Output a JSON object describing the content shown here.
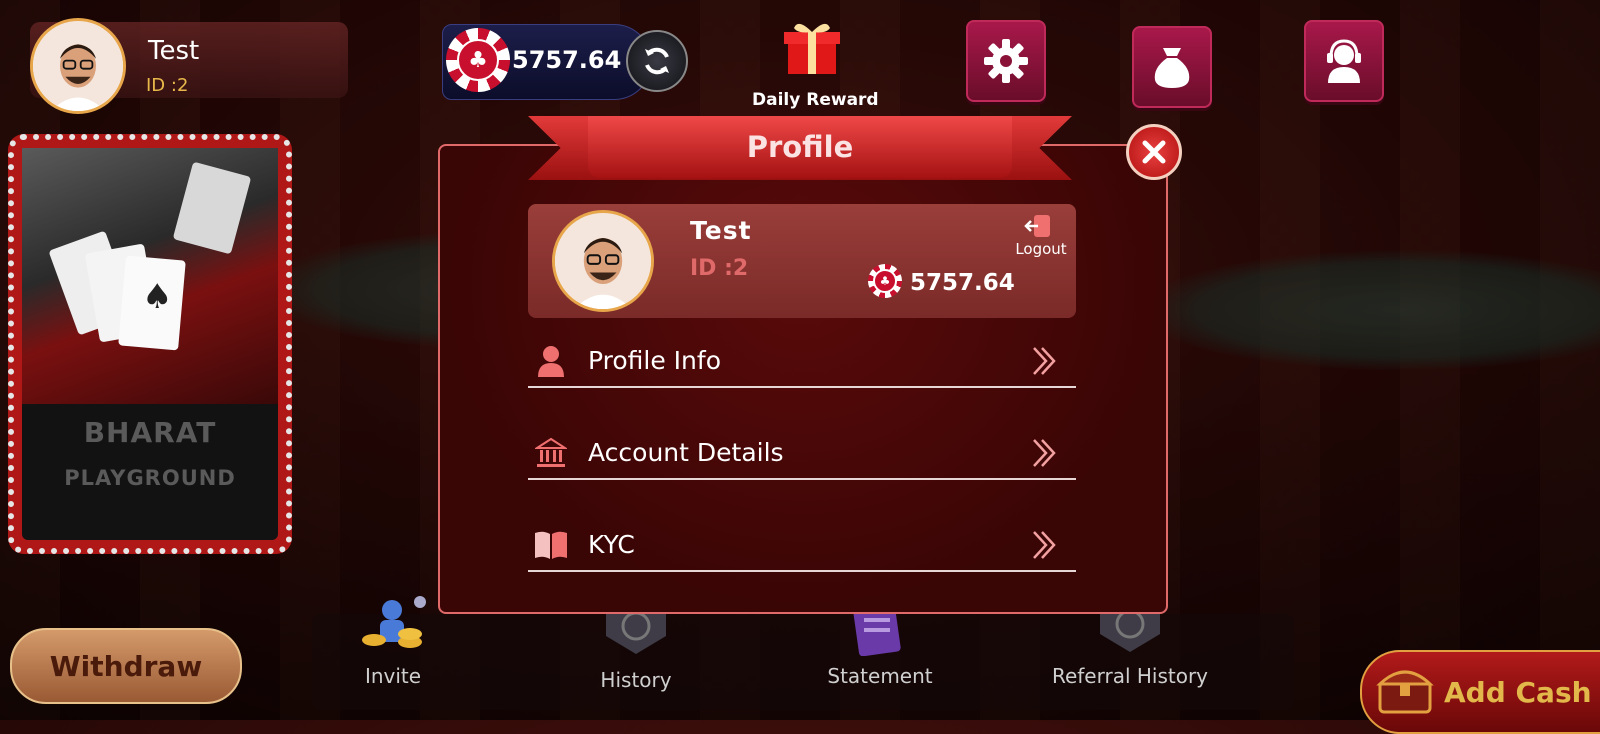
{
  "user": {
    "name": "Test",
    "id_label": "ID :2"
  },
  "balance": {
    "amount": "5757.64"
  },
  "header": {
    "daily_reward_label": "Daily Reward"
  },
  "game_tile": {
    "title": "BHARAT",
    "subtitle": "PLAYGROUND"
  },
  "bottom_nav": {
    "withdraw_label": "Withdraw",
    "items": [
      {
        "label": "Invite"
      },
      {
        "label": "History"
      },
      {
        "label": "Statement"
      },
      {
        "label": "Referral History"
      }
    ],
    "add_cash_label": "Add Cash"
  },
  "profile_dialog": {
    "title": "Profile",
    "user_name": "Test",
    "user_id": "ID :2",
    "balance": "5757.64",
    "logout_label": "Logout",
    "menu": [
      {
        "label": "Profile Info",
        "icon": "person-icon"
      },
      {
        "label": "Account Details",
        "icon": "bank-icon"
      },
      {
        "label": "KYC",
        "icon": "book-icon"
      }
    ]
  },
  "colors": {
    "accent_red": "#c8102e",
    "gold": "#e8b94a",
    "dialog_bg": "#3a0505"
  }
}
